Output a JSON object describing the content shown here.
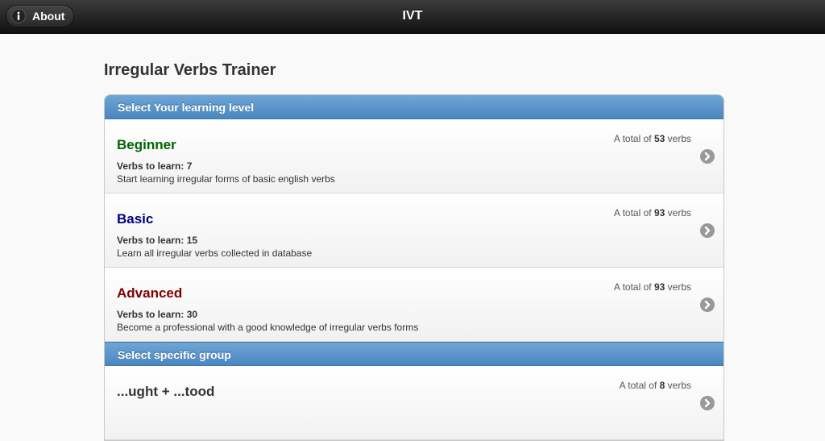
{
  "header": {
    "about_label": "About",
    "title": "IVT"
  },
  "page": {
    "title": "Irregular Verbs Trainer"
  },
  "sections": [
    {
      "label": "Select Your learning level",
      "items": [
        {
          "name": "Beginner",
          "color": "#006400",
          "to_learn_label": "Verbs to learn:",
          "to_learn_count": "7",
          "description": "Start learning irregular forms of basic english verbs",
          "total_prefix": "A total of",
          "total_count": "53",
          "total_suffix": "verbs"
        },
        {
          "name": "Basic",
          "color": "#000080",
          "to_learn_label": "Verbs to learn:",
          "to_learn_count": "15",
          "description": "Learn all irregular verbs collected in database",
          "total_prefix": "A total of",
          "total_count": "93",
          "total_suffix": "verbs"
        },
        {
          "name": "Advanced",
          "color": "#800000",
          "to_learn_label": "Verbs to learn:",
          "to_learn_count": "30",
          "description": "Become a professional with a good knowledge of irregular verbs forms",
          "total_prefix": "A total of",
          "total_count": "93",
          "total_suffix": "verbs"
        }
      ]
    },
    {
      "label": "Select specific group",
      "items": [
        {
          "name": "...ught + ...tood",
          "color": "#333333",
          "total_prefix": "A total of",
          "total_count": "8",
          "total_suffix": "verbs"
        }
      ]
    }
  ],
  "colors": {
    "header_bg": "#1a1a1a",
    "divider_bg": "#4a86bf",
    "arrow_icon": "#999999"
  },
  "icons": {
    "about": "info-icon",
    "row_arrow": "arrow-right-circle-icon"
  }
}
